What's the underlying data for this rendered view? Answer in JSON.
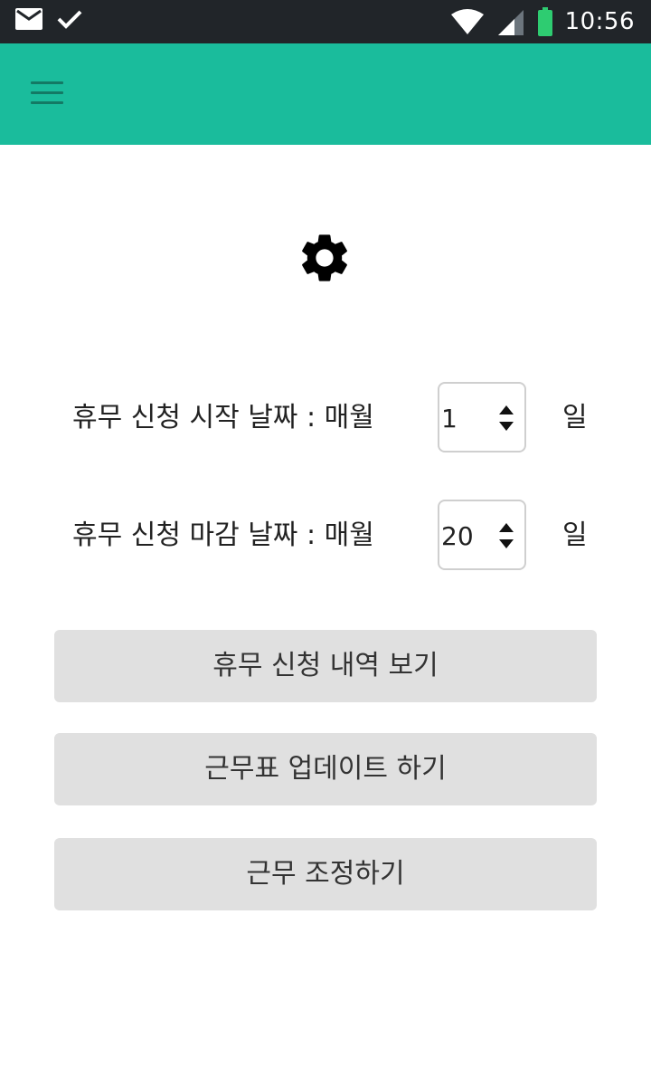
{
  "status_bar": {
    "time": "10:56",
    "icons": [
      "mail-icon",
      "check-icon",
      "wifi-icon",
      "signal-icon",
      "battery-icon"
    ],
    "battery_color": "#2ecc71"
  },
  "app_bar": {
    "background": "#1abc9c",
    "menu_icon": "hamburger-menu-icon"
  },
  "settings": {
    "icon": "gear-icon",
    "start_day": {
      "label": "휴무 신청 시작 날짜 : 매월",
      "value": "1",
      "unit": "일"
    },
    "end_day": {
      "label": "휴무 신청 마감 날짜 : 매월",
      "value": "20",
      "unit": "일"
    }
  },
  "actions": {
    "view_requests": "휴무 신청 내역 보기",
    "update_schedule": "근무표 업데이트 하기",
    "adjust_work": "근무 조정하기"
  }
}
